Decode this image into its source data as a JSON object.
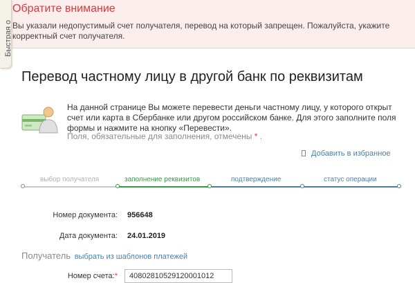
{
  "side_tab": {
    "label": "Быстрая о"
  },
  "alert": {
    "title": "Обратите внимание",
    "text": "Вы указали недопустимый счет получателя, перевод на который запрещен. Пожалуйста, укажите корректный счет получателя."
  },
  "page": {
    "title": "Перевод частному лицу в другой банк по реквизитам"
  },
  "info": {
    "text": "На данной странице Вы можете перевести деньги частному лицу, у которого открыт счет или карта в Сбербанке или другом российском банке. Для этого заполните поля формы и нажмите на кнопку «Перевести».",
    "required_text": "Поля, обязательные для заполнения, отмечены",
    "required_star": "*",
    "required_end": "."
  },
  "favorites": {
    "label": "Добавить в избранное"
  },
  "steps": [
    {
      "label": "выбор получателя",
      "state": "done"
    },
    {
      "label": "заполнение реквизитов",
      "state": "active"
    },
    {
      "label": "подтверждение",
      "state": "pending"
    },
    {
      "label": "статус операции",
      "state": "pending"
    }
  ],
  "colors": {
    "active": "#2e9e3f",
    "pending": "#4a7fa8",
    "done": "#b0b0b0",
    "alert_title": "#d43b3b"
  },
  "document": {
    "number_label": "Номер документа:",
    "number_value": "956648",
    "date_label": "Дата документа:",
    "date_value": "24.01.2019"
  },
  "recipient": {
    "title": "Получатель",
    "templates_link": "выбрать из шаблонов платежей",
    "account_label": "Номер счета:",
    "account_star": "*",
    "account_value": "40802810529120001012"
  }
}
